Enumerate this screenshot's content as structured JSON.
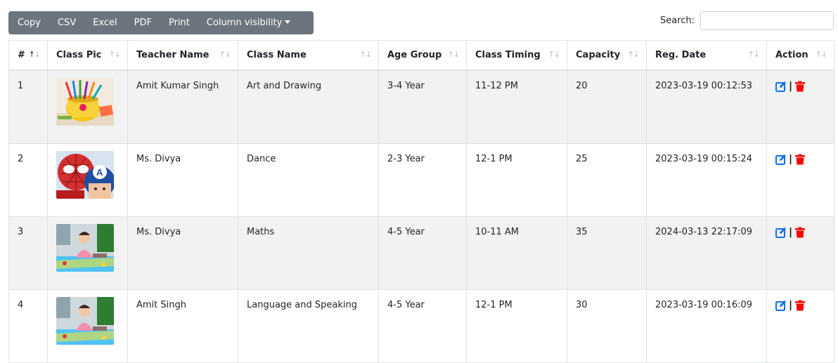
{
  "toolbar": {
    "buttons": [
      "Copy",
      "CSV",
      "Excel",
      "PDF",
      "Print",
      "Column visibility"
    ]
  },
  "search": {
    "label": "Search:",
    "value": "",
    "placeholder": ""
  },
  "table": {
    "headers": [
      "#",
      "Class Pic",
      "Teacher Name",
      "Class Name",
      "Age Group",
      "Class Timing",
      "Capacity",
      "Reg. Date",
      "Action"
    ],
    "rows": [
      {
        "num": "1",
        "teacher": "Amit Kumar Singh",
        "class_name": "Art and Drawing",
        "age_group": "3-4 Year",
        "timing": "11-12 PM",
        "capacity": "20",
        "reg_date": "2023-03-19 00:12:53",
        "pic": "art-supplies-image"
      },
      {
        "num": "2",
        "teacher": "Ms. Divya",
        "class_name": "Dance",
        "age_group": "2-3 Year",
        "timing": "12-1 PM",
        "capacity": "25",
        "reg_date": "2023-03-19 00:15:24",
        "pic": "superhero-kids-image"
      },
      {
        "num": "3",
        "teacher": "Ms. Divya",
        "class_name": "Maths",
        "age_group": "4-5 Year",
        "timing": "10-11 AM",
        "capacity": "35",
        "reg_date": "2024-03-13 22:17:09",
        "pic": "child-learning-image"
      },
      {
        "num": "4",
        "teacher": "Amit Singh",
        "class_name": "Language and Speaking",
        "age_group": "4-5 Year",
        "timing": "12-1 PM",
        "capacity": "30",
        "reg_date": "2023-03-19 00:16:09",
        "pic": "child-learning-image"
      }
    ],
    "action_separator": "|"
  },
  "colors": {
    "toolbar_bg": "#6c757d",
    "edit_icon": "#0d6efd",
    "delete_icon": "#ff0000",
    "stripe": "#f2f2f2"
  },
  "icons": {
    "sort": "sort-arrows-icon",
    "edit": "edit-square-icon",
    "delete": "trash-icon"
  }
}
